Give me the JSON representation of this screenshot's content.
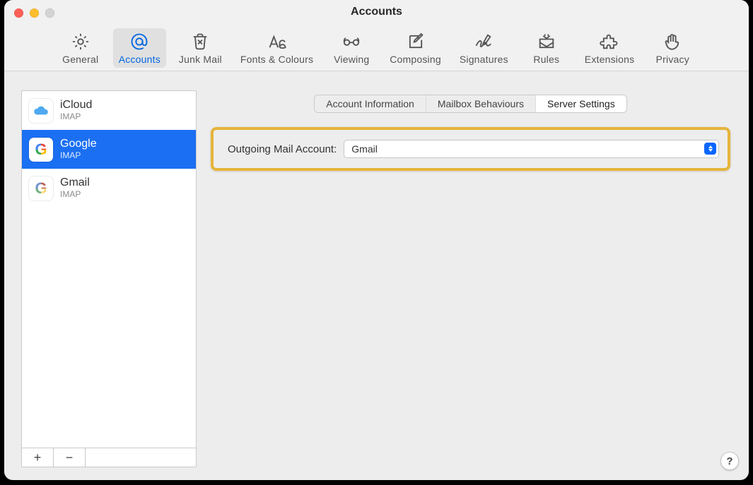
{
  "window": {
    "title": "Accounts"
  },
  "toolbar": {
    "items": [
      {
        "id": "general",
        "label": "General"
      },
      {
        "id": "accounts",
        "label": "Accounts",
        "selected": true
      },
      {
        "id": "junk",
        "label": "Junk Mail"
      },
      {
        "id": "fonts",
        "label": "Fonts & Colours"
      },
      {
        "id": "viewing",
        "label": "Viewing"
      },
      {
        "id": "composing",
        "label": "Composing"
      },
      {
        "id": "signatures",
        "label": "Signatures"
      },
      {
        "id": "rules",
        "label": "Rules"
      },
      {
        "id": "extensions",
        "label": "Extensions"
      },
      {
        "id": "privacy",
        "label": "Privacy"
      }
    ]
  },
  "sidebar": {
    "accounts": [
      {
        "name": "iCloud",
        "protocol": "IMAP",
        "icon": "icloud"
      },
      {
        "name": "Google",
        "protocol": "IMAP",
        "icon": "google",
        "selected": true
      },
      {
        "name": "Gmail",
        "protocol": "IMAP",
        "icon": "gmail"
      }
    ],
    "footer": {
      "add": "+",
      "remove": "−"
    }
  },
  "tabs": [
    {
      "label": "Account Information"
    },
    {
      "label": "Mailbox Behaviours"
    },
    {
      "label": "Server Settings",
      "active": true
    }
  ],
  "form": {
    "outgoing_label": "Outgoing Mail Account:",
    "outgoing_value": "Gmail"
  },
  "help": "?",
  "colors": {
    "selection": "#1b6ff2",
    "highlight_border": "#e5b43a"
  }
}
